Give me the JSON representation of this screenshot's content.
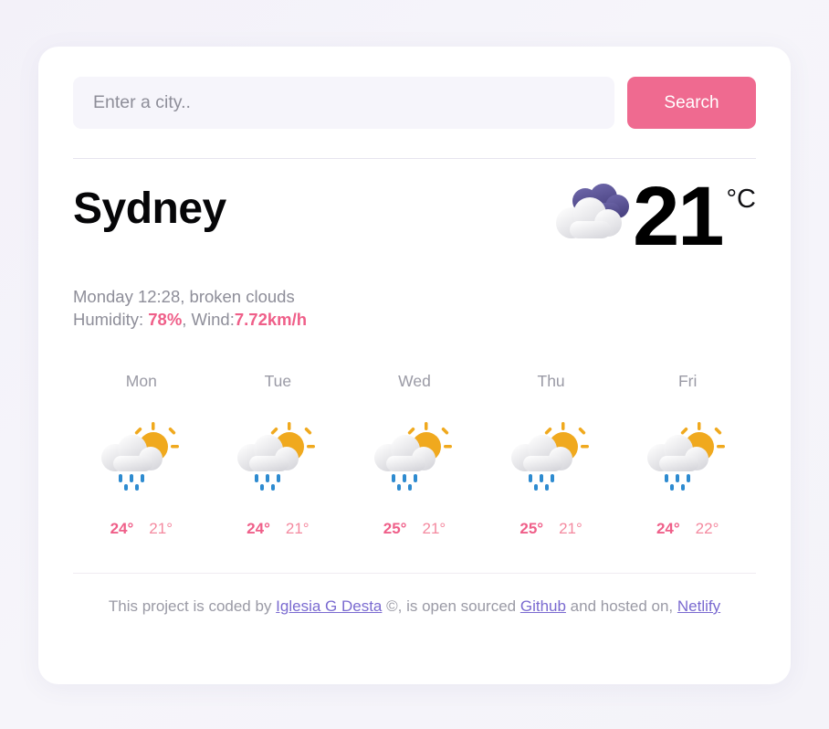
{
  "search": {
    "placeholder": "Enter a city..",
    "value": "",
    "button_label": "Search"
  },
  "current": {
    "city": "Sydney",
    "temperature": "21",
    "unit": "°C",
    "icon": "broken-clouds-icon",
    "datetime_and_condition": "Monday 12:28, broken clouds",
    "humidity_label": "Humidity: ",
    "humidity_value": "78%",
    "wind_label": ", Wind:",
    "wind_value": "7.72km/h"
  },
  "forecast": [
    {
      "day": "Mon",
      "icon": "rain-sun-cloud-icon",
      "max": "24°",
      "min": "21°"
    },
    {
      "day": "Tue",
      "icon": "rain-sun-cloud-icon",
      "max": "24°",
      "min": "21°"
    },
    {
      "day": "Wed",
      "icon": "rain-sun-cloud-icon",
      "max": "25°",
      "min": "21°"
    },
    {
      "day": "Thu",
      "icon": "rain-sun-cloud-icon",
      "max": "25°",
      "min": "21°"
    },
    {
      "day": "Fri",
      "icon": "rain-sun-cloud-icon",
      "max": "24°",
      "min": "22°"
    }
  ],
  "footer": {
    "text_1": "This project is coded by ",
    "link_author": "Iglesia G Desta",
    "text_2": " ©, is open sourced ",
    "link_github": "Github",
    "text_3": " and hosted on, ",
    "link_netlify": "Netlify"
  },
  "colors": {
    "accent_pink": "#ef6a90",
    "temp_max": "#ef5f89",
    "temp_min": "#f4899f",
    "link_purple": "#7a6ad0",
    "page_background": "#f4f3f9",
    "card_background": "#ffffff",
    "input_background": "#f6f5fb",
    "sun_amber": "#f0a91e",
    "rain_blue": "#2e8bd0",
    "cloud_purple": "#504a8c"
  }
}
